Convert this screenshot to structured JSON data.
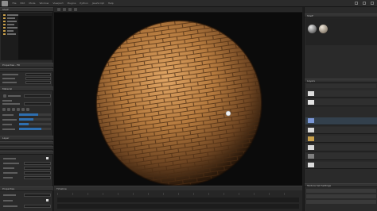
{
  "menubar": {
    "items": [
      "File",
      "Edit",
      "Mode",
      "Window",
      "Viewport",
      "Plugins",
      "Python",
      "JavaScript",
      "Help"
    ]
  },
  "left_panel": {
    "section_1_title": "Shelf",
    "section_2_title": "Properties - Fill",
    "section_3_title": "Material",
    "section_4_title": "Layer",
    "footer_title": "Properties"
  },
  "right_panel": {
    "shelf_title": "Shelf",
    "layers_title": "Layers",
    "texture_set_title": "Texture Set Settings"
  },
  "timeline": {
    "title": "Timeline"
  },
  "colors": {
    "accent": "#2e6fb0",
    "viewport_bg": "#0b0b0b",
    "panel_bg": "#2a2a2a",
    "sphere_base": "#b57a3e"
  },
  "icons": [
    "minimize-icon",
    "maximize-icon",
    "close-icon",
    "eye-icon",
    "folder-icon"
  ]
}
